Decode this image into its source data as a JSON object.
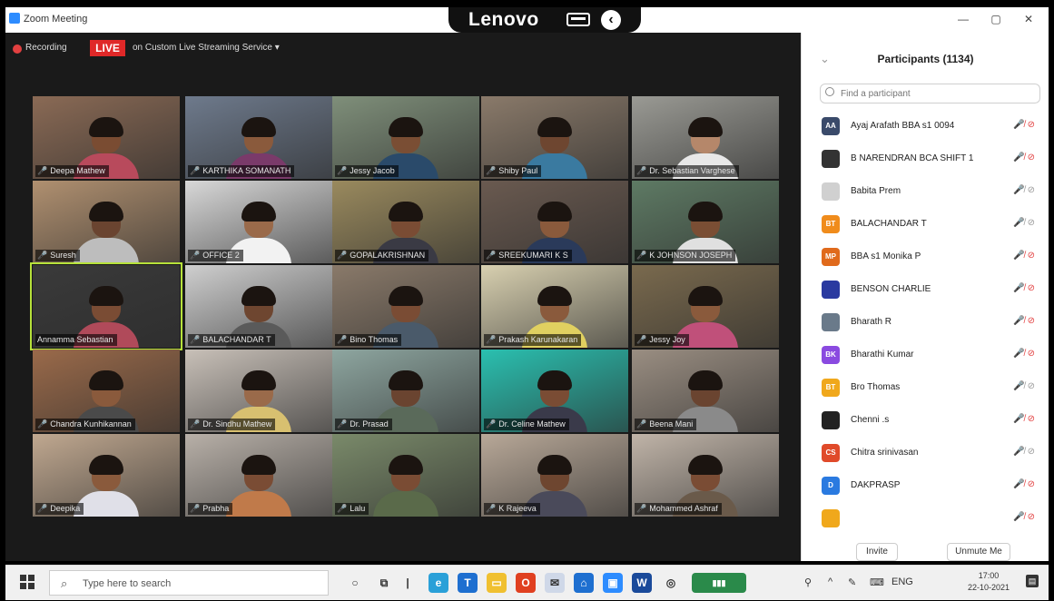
{
  "window": {
    "title": "Zoom Meeting",
    "minimize": "—",
    "maximize": "▢",
    "close": "✕"
  },
  "bezel": {
    "brand": "Lenovo"
  },
  "meeting": {
    "recording_label": "Recording",
    "live_badge": "LIVE",
    "stream_label": "on Custom Live Streaming Service ▾",
    "tiles": [
      {
        "name": "Deepa Mathew",
        "muted": true,
        "bg": "#8a6a55",
        "skin": "#7a4c32",
        "shirt": "#b84a5c",
        "speaker": false
      },
      {
        "name": "KARTHIKA SOMANATH",
        "muted": true,
        "bg": "#6e7a8c",
        "skin": "#8a5a3c",
        "shirt": "#7a3a6a",
        "speaker": false
      },
      {
        "name": "Jessy Jacob",
        "muted": true,
        "bg": "#7f8f7a",
        "skin": "#7a4e34",
        "shirt": "#2a4a6a",
        "speaker": false
      },
      {
        "name": "Shiby Paul",
        "muted": true,
        "bg": "#8a7a6a",
        "skin": "#6e4630",
        "shirt": "#3a7aa0",
        "speaker": false
      },
      {
        "name": "Dr. Sebastian Varghese",
        "muted": true,
        "bg": "#9a9a94",
        "skin": "#b5876a",
        "shirt": "#e8e8e8",
        "speaker": false
      },
      {
        "name": "Suresh",
        "muted": true,
        "bg": "#b09070",
        "skin": "#6a4430",
        "shirt": "#bdbdbd",
        "speaker": false
      },
      {
        "name": "OFFICE 2",
        "muted": true,
        "bg": "#d8d8d8",
        "skin": "#9a6a4a",
        "shirt": "#f2f2f2",
        "speaker": false
      },
      {
        "name": "GOPALAKRISHNAN",
        "muted": true,
        "bg": "#9a8a5e",
        "skin": "#7a4c34",
        "shirt": "#3a3a44",
        "speaker": false
      },
      {
        "name": "SREEKUMARI K S",
        "muted": true,
        "bg": "#6a5a50",
        "skin": "#8a5a3c",
        "shirt": "#2a3a5a",
        "speaker": false
      },
      {
        "name": "K JOHNSON JOSEPH",
        "muted": true,
        "bg": "#5e7a64",
        "skin": "#7a4e34",
        "shirt": "#e0e0e0",
        "speaker": false
      },
      {
        "name": "Annamma Sebastian",
        "muted": false,
        "bg": "#3a3a3a",
        "skin": "#7a4c34",
        "shirt": "#b04a5a",
        "speaker": true
      },
      {
        "name": "BALACHANDAR T",
        "muted": true,
        "bg": "#cfcfcf",
        "skin": "#6e4630",
        "shirt": "#5a5a5a",
        "speaker": false
      },
      {
        "name": "Bino Thomas",
        "muted": true,
        "bg": "#8a7a6a",
        "skin": "#7a4c34",
        "shirt": "#4a5a6a",
        "speaker": false
      },
      {
        "name": "Prakash Karunakaran",
        "muted": true,
        "bg": "#d8d0b0",
        "skin": "#8a5a3c",
        "shirt": "#e0d060",
        "speaker": false
      },
      {
        "name": "Jessy Joy",
        "muted": true,
        "bg": "#7a6a4e",
        "skin": "#8a5a3c",
        "shirt": "#c0507a",
        "speaker": false
      },
      {
        "name": "Chandra Kunhikannan",
        "muted": true,
        "bg": "#9a6a4a",
        "skin": "#8a5a3c",
        "shirt": "#4a4a4a",
        "speaker": false
      },
      {
        "name": "Dr. Sindhu Mathew",
        "muted": true,
        "bg": "#c8c0b8",
        "skin": "#9a6a4a",
        "shirt": "#d8c070",
        "speaker": false
      },
      {
        "name": "Dr. Prasad",
        "muted": true,
        "bg": "#8ea6a0",
        "skin": "#6a4430",
        "shirt": "#5a6a5a",
        "speaker": false
      },
      {
        "name": "Dr. Celine Mathew",
        "muted": true,
        "bg": "#2ac0b0",
        "skin": "#7a4c34",
        "shirt": "#3a3a4a",
        "speaker": false
      },
      {
        "name": "Beena Mani",
        "muted": true,
        "bg": "#9a8e82",
        "skin": "#6a4430",
        "shirt": "#8a8a8a",
        "speaker": false
      },
      {
        "name": "Deepika",
        "muted": true,
        "bg": "#c0a890",
        "skin": "#8a5a3c",
        "shirt": "#e0e0e8",
        "speaker": false
      },
      {
        "name": "Prabha",
        "muted": true,
        "bg": "#b8b0a8",
        "skin": "#7a4c34",
        "shirt": "#c07a4a",
        "speaker": false
      },
      {
        "name": "Lalu",
        "muted": true,
        "bg": "#7a8a6a",
        "skin": "#7a4c34",
        "shirt": "#5a6a4a",
        "speaker": false
      },
      {
        "name": "K Rajeeva",
        "muted": true,
        "bg": "#b8a898",
        "skin": "#6e4630",
        "shirt": "#4a4a5a",
        "speaker": false
      },
      {
        "name": "Mohammed Ashraf",
        "muted": true,
        "bg": "#c0b4a8",
        "skin": "#7a4c34",
        "shirt": "#6a5a4a",
        "speaker": false
      }
    ]
  },
  "participants": {
    "title": "Participants (1134)",
    "collapse_icon": "⌄",
    "search_placeholder": "Find a participant",
    "list": [
      {
        "initials": "AA",
        "color": "#3a4a6a",
        "name": "Ayaj Arafath BBA s1 0094",
        "video_off": true
      },
      {
        "initials": "",
        "color": "#333333",
        "name": "B NARENDRAN BCA SHIFT 1",
        "video_off": true
      },
      {
        "initials": "",
        "color": "#d0d0d0",
        "name": "Babita Prem",
        "video_off": false
      },
      {
        "initials": "BT",
        "color": "#f08c1c",
        "name": "BALACHANDAR T",
        "video_off": false
      },
      {
        "initials": "MP",
        "color": "#e06a1c",
        "name": "BBA s1 Monika P",
        "video_off": true
      },
      {
        "initials": "",
        "color": "#2a3aa0",
        "name": "BENSON CHARLIE",
        "video_off": true
      },
      {
        "initials": "",
        "color": "#6a7a8a",
        "name": "Bharath R",
        "video_off": true
      },
      {
        "initials": "BK",
        "color": "#8a4ae0",
        "name": "Bharathi Kumar",
        "video_off": true
      },
      {
        "initials": "BT",
        "color": "#f0a81c",
        "name": "Bro Thomas",
        "video_off": false
      },
      {
        "initials": "",
        "color": "#222222",
        "name": "Chenni .s",
        "video_off": true
      },
      {
        "initials": "CS",
        "color": "#e04a2a",
        "name": "Chitra srinivasan",
        "video_off": false
      },
      {
        "initials": "D",
        "color": "#2a7ae0",
        "name": "DAKPRASP",
        "video_off": true
      },
      {
        "initials": "",
        "color": "#f0a81c",
        "name": "",
        "video_off": true
      }
    ],
    "invite_label": "Invite",
    "unmute_label": "Unmute Me"
  },
  "taskbar": {
    "search_placeholder": "Type here to search",
    "clock_time": "17:00",
    "clock_date": "22-10-2021",
    "lang": "ENG"
  }
}
